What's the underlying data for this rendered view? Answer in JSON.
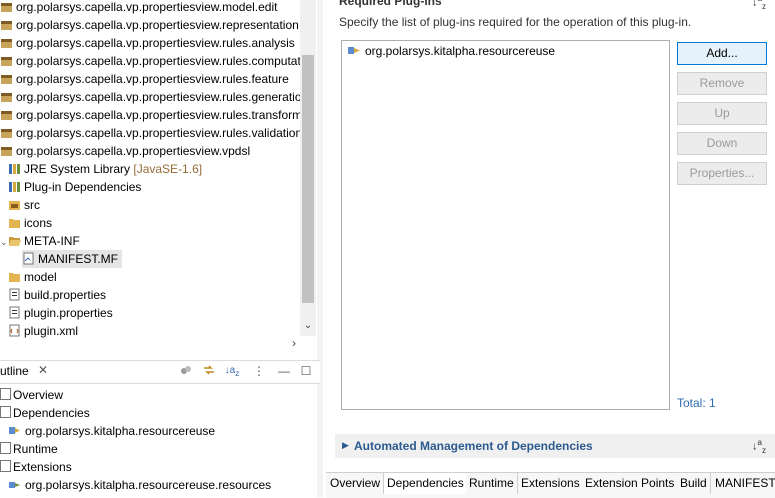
{
  "left_tree": {
    "packages": [
      "org.polarsys.capella.vp.propertiesview.model.edit",
      "org.polarsys.capella.vp.propertiesview.representation.fe",
      "org.polarsys.capella.vp.propertiesview.rules.analysis",
      "org.polarsys.capella.vp.propertiesview.rules.computatio",
      "org.polarsys.capella.vp.propertiesview.rules.feature",
      "org.polarsys.capella.vp.propertiesview.rules.generation",
      "org.polarsys.capella.vp.propertiesview.rules.transforma",
      "org.polarsys.capella.vp.propertiesview.rules.validation",
      "org.polarsys.capella.vp.propertiesview.vpdsl"
    ],
    "jre_label": "JRE System Library",
    "jre_decor": "[JavaSE-1.6]",
    "plugin_deps": "Plug-in Dependencies",
    "src": "src",
    "icons": "icons",
    "meta_inf": "META-INF",
    "manifest": "MANIFEST.MF",
    "model": "model",
    "build_properties": "build.properties",
    "plugin_properties": "plugin.properties",
    "plugin_xml": "plugin.xml"
  },
  "outline": {
    "title": "utline",
    "close": "✕",
    "items": [
      "Overview",
      "Dependencies",
      "org.polarsys.kitalpha.resourcereuse",
      "Runtime",
      "Extensions",
      "org.polarsys.kitalpha.resourcereuse.resources"
    ]
  },
  "editor": {
    "section_title": "Required Plug-ins",
    "section_desc": "Specify the list of plug-ins required for the operation of this plug-in.",
    "plugin_item": "org.polarsys.kitalpha.resourcereuse",
    "buttons": {
      "add": "Add...",
      "remove": "Remove",
      "up": "Up",
      "down": "Down",
      "properties": "Properties..."
    },
    "total": "Total: 1",
    "auto_section": "Automated Management of Dependencies"
  },
  "tabs": [
    "Overview",
    "Dependencies",
    "Runtime",
    "Extensions",
    "Extension Points",
    "Build",
    "MANIFEST."
  ]
}
